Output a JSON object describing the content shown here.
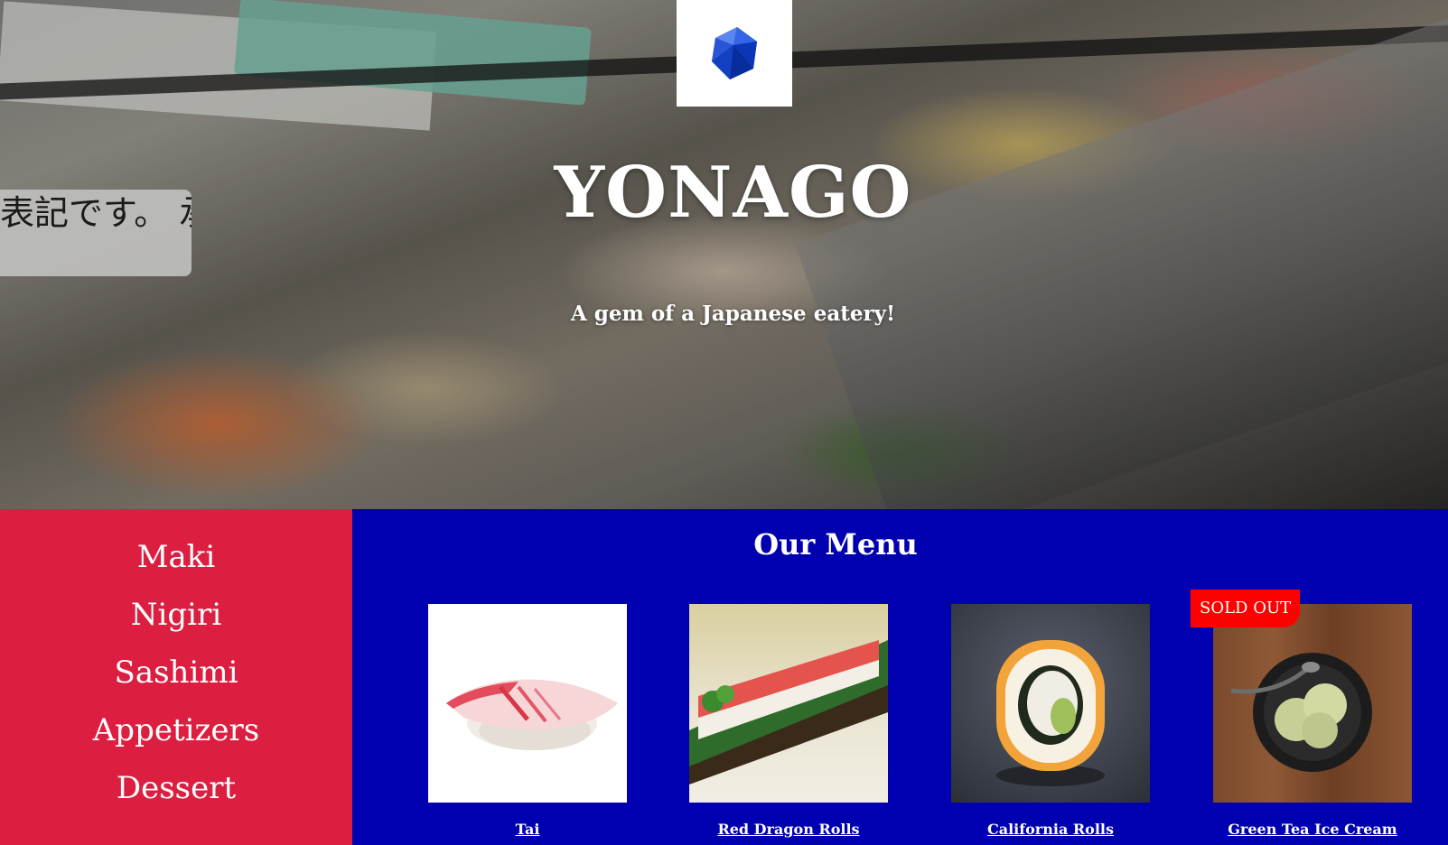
{
  "hero": {
    "title": "YONAGO",
    "tagline": "A gem of a Japanese eatery!",
    "sign_text": "表記です。 承ります。",
    "logo_icon": "ruby-gem-icon"
  },
  "sidebar": {
    "items": [
      {
        "label": "Maki"
      },
      {
        "label": "Nigiri"
      },
      {
        "label": "Sashimi"
      },
      {
        "label": "Appetizers"
      },
      {
        "label": "Dessert"
      }
    ]
  },
  "menu": {
    "heading": "Our Menu",
    "items": [
      {
        "name": "Tai",
        "sold_out": false
      },
      {
        "name": "Red Dragon Rolls",
        "sold_out": false
      },
      {
        "name": "California Rolls",
        "sold_out": false
      },
      {
        "name": "Green Tea Ice Cream",
        "sold_out": true,
        "badge": "SOLD OUT"
      }
    ]
  },
  "colors": {
    "sidebar_bg": "#dc1f40",
    "menu_bg": "#0000b0",
    "badge_bg": "#ff0000",
    "text": "#ffffff"
  }
}
